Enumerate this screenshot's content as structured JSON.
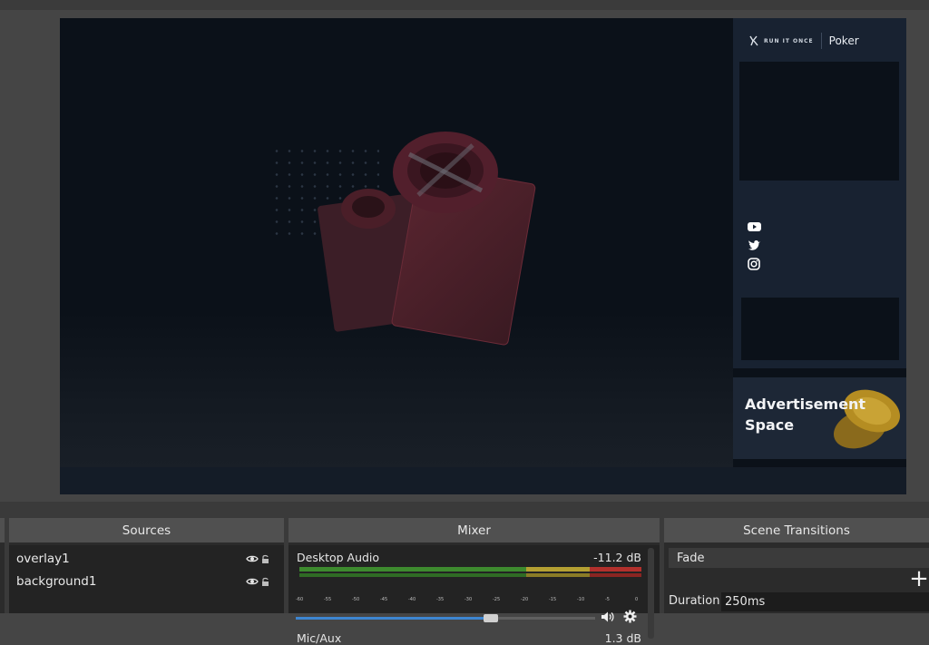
{
  "preview": {
    "brand": {
      "name": "RUN IT ONCE",
      "product": "Poker"
    },
    "social_icons": [
      "youtube-icon",
      "twitter-icon",
      "instagram-icon"
    ],
    "ad_text": "Advertisement Space"
  },
  "sources": {
    "title": "Sources",
    "items": [
      {
        "label": "overlay1",
        "visible": true,
        "locked": false
      },
      {
        "label": "background1",
        "visible": true,
        "locked": false
      }
    ]
  },
  "mixer": {
    "title": "Mixer",
    "channels": [
      {
        "name": "Desktop Audio",
        "level": "-11.2 dB",
        "volume_fraction": 0.65
      },
      {
        "name": "Mic/Aux",
        "level": "1.3 dB"
      }
    ],
    "scale_ticks": [
      "-60",
      "-55",
      "-50",
      "-45",
      "-40",
      "-35",
      "-30",
      "-25",
      "-20",
      "-15",
      "-10",
      "-5",
      "0"
    ],
    "colors": {
      "green": "#3d8a2e",
      "yellow": "#b4a032",
      "red": "#b2302c",
      "volume": "#3d86d1"
    }
  },
  "transitions": {
    "title": "Scene Transitions",
    "selected": "Fade",
    "add_icon": "plus-icon",
    "duration_label": "Duration",
    "duration_value": "250ms"
  }
}
